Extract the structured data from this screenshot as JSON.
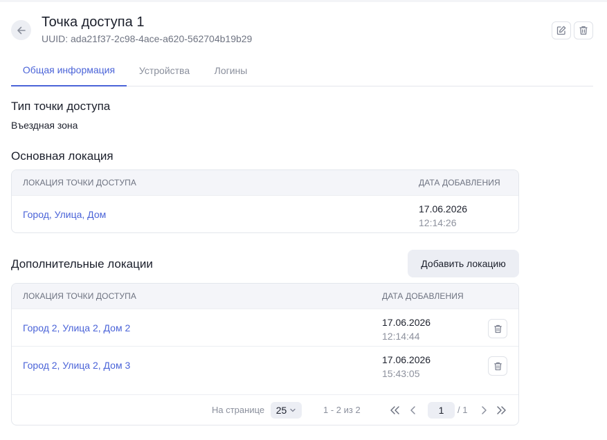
{
  "header": {
    "title": "Точка доступа 1",
    "uuid": "UUID: ada21f37-2c98-4ace-a620-562704b19b29"
  },
  "tabs": [
    {
      "label": "Общая информация",
      "active": true
    },
    {
      "label": "Устройства",
      "active": false
    },
    {
      "label": "Логины",
      "active": false
    }
  ],
  "type_section": {
    "title": "Тип точки доступа",
    "value": "Въездная зона"
  },
  "main_location": {
    "title": "Основная локация",
    "columns": [
      "ЛОКАЦИЯ ТОЧКИ ДОСТУПА",
      "ДАТА ДОБАВЛЕНИЯ"
    ],
    "rows": [
      {
        "location": "Город, Улица, Дом",
        "date": "17.06.2026",
        "time": "12:14:26"
      }
    ]
  },
  "extra_locations": {
    "title": "Дополнительные локации",
    "add_label": "Добавить локацию",
    "columns": [
      "ЛОКАЦИЯ ТОЧКИ ДОСТУПА",
      "ДАТА ДОБАВЛЕНИЯ"
    ],
    "rows": [
      {
        "location": "Город 2, Улица 2, Дом 2",
        "date": "17.06.2026",
        "time": "12:14:44"
      },
      {
        "location": "Город 2, Улица 2, Дом 3",
        "date": "17.06.2026",
        "time": "15:43:05"
      }
    ],
    "pagination": {
      "per_page_label": "На странице",
      "per_page": "25",
      "range": "1 - 2 из 2",
      "current_page": "1",
      "total_pages": "/ 1"
    }
  },
  "colors": {
    "accent": "#4a63d8",
    "muted_text": "#8a8f9c",
    "header_bg": "#f4f5f9"
  },
  "icons": [
    "arrow-left-icon",
    "edit-icon",
    "trash-icon",
    "chevron-down-icon",
    "chevrons-left-icon",
    "chevron-left-icon",
    "chevron-right-icon",
    "chevrons-right-icon"
  ]
}
